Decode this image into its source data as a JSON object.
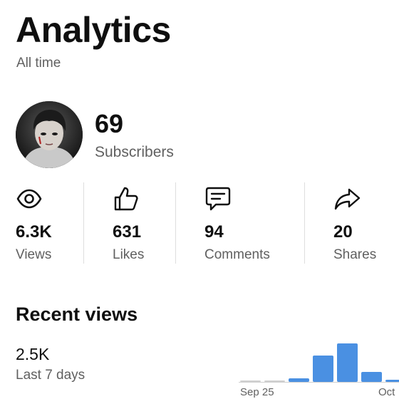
{
  "header": {
    "title": "Analytics",
    "period": "All time"
  },
  "channel": {
    "subscribers_value": "69",
    "subscribers_label": "Subscribers"
  },
  "stats": [
    {
      "icon": "eye-icon",
      "value": "6.3K",
      "label": "Views"
    },
    {
      "icon": "thumbs-up-icon",
      "value": "631",
      "label": "Likes"
    },
    {
      "icon": "comment-icon",
      "value": "94",
      "label": "Comments"
    },
    {
      "icon": "share-icon",
      "value": "20",
      "label": "Shares"
    }
  ],
  "recent": {
    "title": "Recent views",
    "value": "2.5K",
    "subtitle": "Last 7 days"
  },
  "colors": {
    "accent": "#4a90e2",
    "muted": "#606060",
    "baseline": "#cfcfcf"
  },
  "chart_data": {
    "type": "bar",
    "x_tick_labels": [
      "Sep 25",
      "Oct"
    ],
    "categories": [
      "b1",
      "b2",
      "b3",
      "b4",
      "b5",
      "b6",
      "b7"
    ],
    "values": [
      2,
      2,
      5,
      37,
      54,
      14,
      3
    ],
    "ylim": [
      0,
      60
    ],
    "title": "",
    "xlabel": "",
    "ylabel": ""
  }
}
